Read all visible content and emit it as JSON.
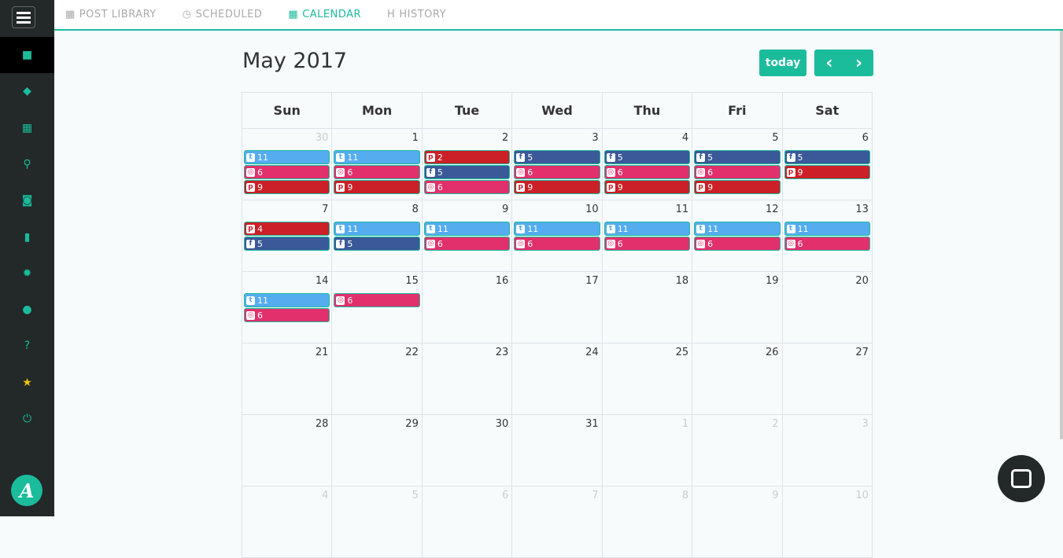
{
  "nav": {
    "tabs": [
      {
        "label": "POST LIBRARY",
        "icon": "▦"
      },
      {
        "label": "SCHEDULED",
        "icon": "◷"
      },
      {
        "label": "CALENDAR",
        "icon": "▦",
        "active": true
      },
      {
        "label": "HISTORY",
        "icon": "H"
      }
    ]
  },
  "sidebar": {
    "items": [
      {
        "name": "briefcase",
        "glyph": "■"
      },
      {
        "name": "tags",
        "glyph": "◆"
      },
      {
        "name": "calendar",
        "glyph": "▦"
      },
      {
        "name": "search",
        "glyph": "⚲"
      },
      {
        "name": "camera",
        "glyph": "◙"
      },
      {
        "name": "chart",
        "glyph": "▮"
      },
      {
        "name": "gear",
        "glyph": "✹"
      },
      {
        "name": "user",
        "glyph": "●"
      },
      {
        "name": "help",
        "glyph": "?"
      },
      {
        "name": "star",
        "glyph": "★"
      },
      {
        "name": "power",
        "glyph": "⏻"
      }
    ],
    "logo": "A"
  },
  "calendar": {
    "title": "May 2017",
    "today_label": "today",
    "prev": "‹",
    "next": "›",
    "weekdays": [
      "Sun",
      "Mon",
      "Tue",
      "Wed",
      "Thu",
      "Fri",
      "Sat"
    ],
    "colors": {
      "tw": "#55acee",
      "ig": "#e1306c",
      "pi": "#cb2027",
      "fb": "#3b5998"
    },
    "icons": {
      "tw": "t",
      "ig": "◎",
      "pi": "p",
      "fb": "f"
    },
    "weeks": [
      [
        {
          "d": "30",
          "o": true,
          "e": [
            [
              "tw",
              "11"
            ],
            [
              "ig",
              "6"
            ],
            [
              "pi",
              "9"
            ]
          ]
        },
        {
          "d": "1",
          "e": [
            [
              "tw",
              "11"
            ],
            [
              "ig",
              "6"
            ],
            [
              "pi",
              "9"
            ]
          ]
        },
        {
          "d": "2",
          "e": [
            [
              "pi",
              "2"
            ],
            [
              "fb",
              "5"
            ],
            [
              "ig",
              "6"
            ]
          ]
        },
        {
          "d": "3",
          "e": [
            [
              "fb",
              "5"
            ],
            [
              "ig",
              "6"
            ],
            [
              "pi",
              "9"
            ]
          ]
        },
        {
          "d": "4",
          "e": [
            [
              "fb",
              "5"
            ],
            [
              "ig",
              "6"
            ],
            [
              "pi",
              "9"
            ]
          ]
        },
        {
          "d": "5",
          "e": [
            [
              "fb",
              "5"
            ],
            [
              "ig",
              "6"
            ],
            [
              "pi",
              "9"
            ]
          ]
        },
        {
          "d": "6",
          "e": [
            [
              "fb",
              "5"
            ],
            [
              "pi",
              "9"
            ]
          ]
        }
      ],
      [
        {
          "d": "7",
          "e": [
            [
              "pi",
              "4"
            ],
            [
              "fb",
              "5"
            ]
          ]
        },
        {
          "d": "8",
          "e": [
            [
              "tw",
              "11"
            ],
            [
              "fb",
              "5"
            ]
          ]
        },
        {
          "d": "9",
          "e": [
            [
              "tw",
              "11"
            ],
            [
              "ig",
              "6"
            ]
          ]
        },
        {
          "d": "10",
          "e": [
            [
              "tw",
              "11"
            ],
            [
              "ig",
              "6"
            ]
          ]
        },
        {
          "d": "11",
          "e": [
            [
              "tw",
              "11"
            ],
            [
              "ig",
              "6"
            ]
          ]
        },
        {
          "d": "12",
          "e": [
            [
              "tw",
              "11"
            ],
            [
              "ig",
              "6"
            ]
          ]
        },
        {
          "d": "13",
          "e": [
            [
              "tw",
              "11"
            ],
            [
              "ig",
              "6"
            ]
          ]
        }
      ],
      [
        {
          "d": "14",
          "e": [
            [
              "tw",
              "11"
            ],
            [
              "ig",
              "6"
            ]
          ]
        },
        {
          "d": "15",
          "e": [
            [
              "ig",
              "6"
            ]
          ]
        },
        {
          "d": "16",
          "e": []
        },
        {
          "d": "17",
          "e": []
        },
        {
          "d": "18",
          "e": []
        },
        {
          "d": "19",
          "e": []
        },
        {
          "d": "20",
          "e": []
        }
      ],
      [
        {
          "d": "21",
          "e": []
        },
        {
          "d": "22",
          "e": []
        },
        {
          "d": "23",
          "e": []
        },
        {
          "d": "24",
          "e": []
        },
        {
          "d": "25",
          "e": []
        },
        {
          "d": "26",
          "e": []
        },
        {
          "d": "27",
          "e": []
        }
      ],
      [
        {
          "d": "28",
          "e": []
        },
        {
          "d": "29",
          "e": []
        },
        {
          "d": "30",
          "e": []
        },
        {
          "d": "31",
          "e": []
        },
        {
          "d": "1",
          "o": true,
          "e": []
        },
        {
          "d": "2",
          "o": true,
          "e": []
        },
        {
          "d": "3",
          "o": true,
          "e": []
        }
      ],
      [
        {
          "d": "4",
          "o": true,
          "e": []
        },
        {
          "d": "5",
          "o": true,
          "e": []
        },
        {
          "d": "6",
          "o": true,
          "e": []
        },
        {
          "d": "7",
          "o": true,
          "e": []
        },
        {
          "d": "8",
          "o": true,
          "e": []
        },
        {
          "d": "9",
          "o": true,
          "e": []
        },
        {
          "d": "10",
          "o": true,
          "e": []
        }
      ]
    ]
  }
}
